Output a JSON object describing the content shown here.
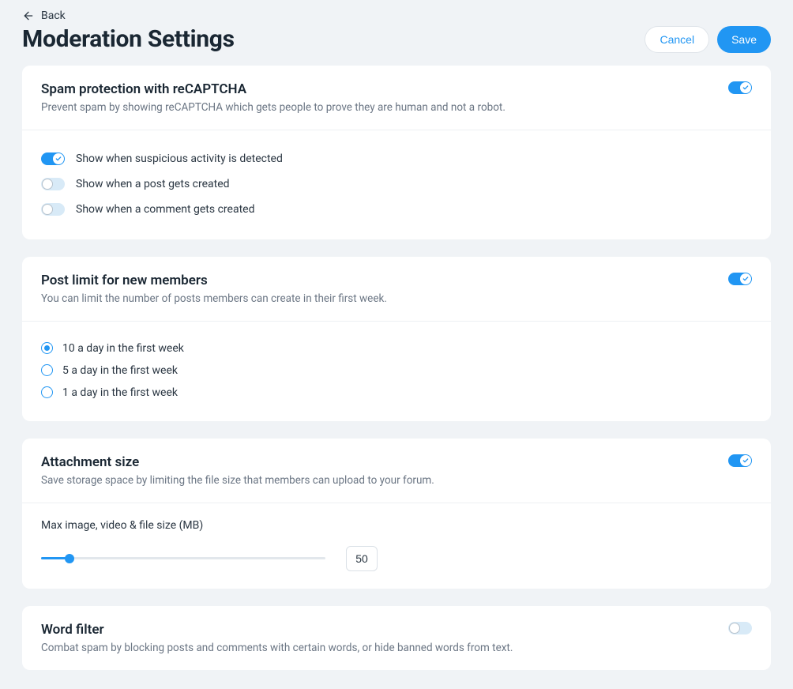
{
  "nav": {
    "back": "Back"
  },
  "header": {
    "title": "Moderation Settings",
    "cancel": "Cancel",
    "save": "Save"
  },
  "recaptcha": {
    "title": "Spam protection with reCAPTCHA",
    "desc": "Prevent spam by showing reCAPTCHA which gets people to prove they are human and not a robot.",
    "enabled": true,
    "options": {
      "suspicious": {
        "label": "Show when suspicious activity is detected",
        "on": true
      },
      "postCreated": {
        "label": "Show when a post gets created",
        "on": false
      },
      "commentCreated": {
        "label": "Show when a comment gets created",
        "on": false
      }
    }
  },
  "postLimit": {
    "title": "Post limit for new members",
    "desc": "You can limit the number of posts members can create in their first week.",
    "enabled": true,
    "selected": "10",
    "options": {
      "ten": "10 a day in the first week",
      "five": "5 a day in the first week",
      "one": "1 a day in the first week"
    }
  },
  "attachment": {
    "title": "Attachment size",
    "desc": "Save storage space by limiting the file size that members can upload to your forum.",
    "enabled": true,
    "sliderLabel": "Max image, video & file size (MB)",
    "value": "50",
    "percent": 10
  },
  "wordFilter": {
    "title": "Word filter",
    "desc": "Combat spam by blocking posts and comments with certain words, or hide banned words from text.",
    "enabled": false
  }
}
